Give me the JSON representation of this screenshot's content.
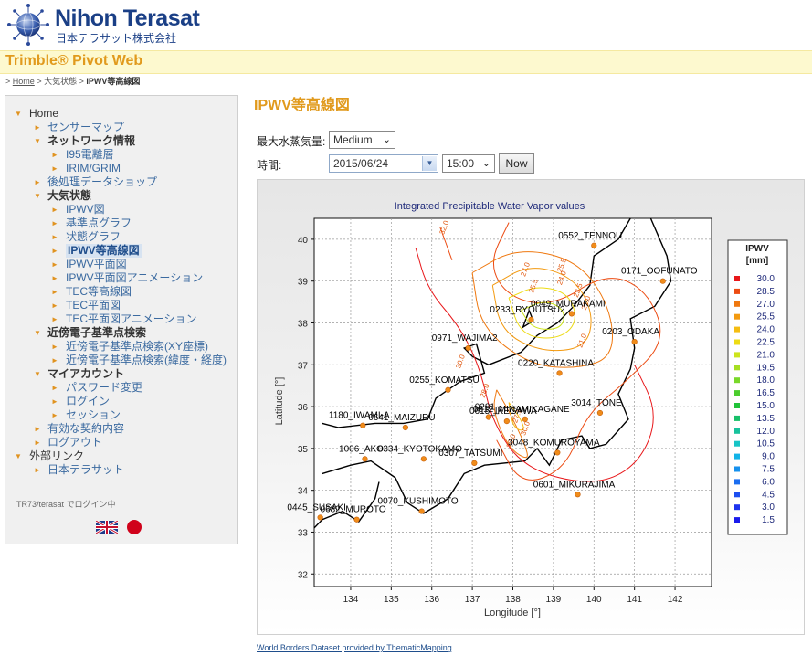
{
  "header": {
    "company_en": "Nihon Terasat",
    "company_ja": "日本テラサット株式会社",
    "app_title": "Trimble® Pivot Web"
  },
  "breadcrumb": {
    "prefix": ">",
    "home": "Home",
    "sep1": ">",
    "item1": "大気状態",
    "sep2": ">",
    "current": "IPWV等高線図"
  },
  "sidebar": {
    "items": [
      {
        "label": "Home"
      },
      {
        "label": "センサーマップ"
      },
      {
        "label": "ネットワーク情報"
      },
      {
        "label": "I95電離層"
      },
      {
        "label": "IRIM/GRIM"
      },
      {
        "label": "後処理データショップ"
      },
      {
        "label": "大気状態"
      },
      {
        "label": "IPWV図"
      },
      {
        "label": "基準点グラフ"
      },
      {
        "label": "状態グラフ"
      },
      {
        "label": "IPWV等高線図"
      },
      {
        "label": "IPWV平面図"
      },
      {
        "label": "IPWV平面図アニメーション"
      },
      {
        "label": "TEC等高線図"
      },
      {
        "label": "TEC平面図"
      },
      {
        "label": "TEC平面図アニメーション"
      },
      {
        "label": "近傍電子基準点検索"
      },
      {
        "label": "近傍電子基準点検索(XY座標)"
      },
      {
        "label": "近傍電子基準点検索(緯度・経度)"
      },
      {
        "label": "マイアカウント"
      },
      {
        "label": "パスワード変更"
      },
      {
        "label": "ログイン"
      },
      {
        "label": "セッション"
      },
      {
        "label": "有効な契約内容"
      },
      {
        "label": "ログアウト"
      },
      {
        "label": "外部リンク"
      },
      {
        "label": "日本テラサット"
      }
    ],
    "user_status": "TR73/terasat でログイン中"
  },
  "main": {
    "title": "IPWV等高線図",
    "max_label": "最大水蒸気量:",
    "max_value": "Medium",
    "time_label": "時間:",
    "date_value": "2015/06/24",
    "hour_value": "15:00",
    "now_button": "Now",
    "credit": "World Borders Dataset provided by ThematicMapping"
  },
  "chart_data": {
    "type": "contour",
    "title": "Integrated Precipitable Water Vapor values",
    "xlabel": "Longitude [°]",
    "ylabel": "Latitude [°]",
    "xlim": [
      133.1,
      142.9
    ],
    "ylim": [
      31.7,
      40.5
    ],
    "xticks": [
      134,
      135,
      136,
      137,
      138,
      139,
      140,
      141,
      142
    ],
    "yticks": [
      32,
      33,
      34,
      35,
      36,
      37,
      38,
      39,
      40
    ],
    "grid": true,
    "legend": {
      "title": "IPWV",
      "unit": "[mm]",
      "placement": "right",
      "levels": [
        {
          "value": "30.0",
          "color": "#e8171a"
        },
        {
          "value": "28.5",
          "color": "#ec4b12"
        },
        {
          "value": "27.0",
          "color": "#ef780f"
        },
        {
          "value": "25.5",
          "color": "#f39a10"
        },
        {
          "value": "24.0",
          "color": "#f5bd12"
        },
        {
          "value": "22.5",
          "color": "#eddb14"
        },
        {
          "value": "21.0",
          "color": "#cde41c"
        },
        {
          "value": "19.5",
          "color": "#a6df22"
        },
        {
          "value": "18.0",
          "color": "#79d82a"
        },
        {
          "value": "16.5",
          "color": "#4ccd2e"
        },
        {
          "value": "15.0",
          "color": "#22c33a"
        },
        {
          "value": "13.5",
          "color": "#18c06a"
        },
        {
          "value": "12.0",
          "color": "#18c29c"
        },
        {
          "value": "10.5",
          "color": "#17c4c6"
        },
        {
          "value": "9.0",
          "color": "#13b4e8"
        },
        {
          "value": "7.5",
          "color": "#1691ee"
        },
        {
          "value": "6.0",
          "color": "#1a6df0"
        },
        {
          "value": "4.5",
          "color": "#1c4ef0"
        },
        {
          "value": "3.0",
          "color": "#1d33ee"
        },
        {
          "value": "1.5",
          "color": "#1a1bec"
        }
      ]
    },
    "stations": [
      {
        "id": "0552_TENNOU",
        "lon": 140.0,
        "lat": 39.85
      },
      {
        "id": "0171_OOFUNATO",
        "lon": 141.7,
        "lat": 39.0
      },
      {
        "id": "0049_MURAKAMI",
        "lon": 139.45,
        "lat": 38.22
      },
      {
        "id": "0233_RYOUTSU2",
        "lon": 138.45,
        "lat": 38.08
      },
      {
        "id": "0971_WAJIMA2",
        "lon": 136.9,
        "lat": 37.4
      },
      {
        "id": "0203_ODAKA",
        "lon": 141.0,
        "lat": 37.55
      },
      {
        "id": "0220_KATASHINA",
        "lon": 139.15,
        "lat": 36.8
      },
      {
        "id": "0255_KOMATSU",
        "lon": 136.4,
        "lat": 36.4
      },
      {
        "id": "3014_TONE",
        "lon": 140.15,
        "lat": 35.85
      },
      {
        "id": "0281",
        "lon": 137.4,
        "lat": 35.75
      },
      {
        "id": "0615_IKEGAWA",
        "lon": 137.85,
        "lat": 35.65
      },
      {
        "id": "0612_MINAMIKAGANE",
        "lon": 138.3,
        "lat": 35.7
      },
      {
        "id": "1180_IWAMI-A",
        "lon": 134.3,
        "lat": 35.55
      },
      {
        "id": "0641_MAIZURU",
        "lon": 135.35,
        "lat": 35.5
      },
      {
        "id": "3048_KOMUROYAMA",
        "lon": 139.1,
        "lat": 34.9
      },
      {
        "id": "1006_AKO",
        "lon": 134.35,
        "lat": 34.75
      },
      {
        "id": "0334_KYOTOKAMO",
        "lon": 135.8,
        "lat": 34.75
      },
      {
        "id": "0307_TATSUMI",
        "lon": 137.05,
        "lat": 34.65
      },
      {
        "id": "0601_MIKURAJIMA",
        "lon": 139.6,
        "lat": 33.9
      },
      {
        "id": "0445_SUSAKI",
        "lon": 133.25,
        "lat": 33.35
      },
      {
        "id": "0682_MUROTO",
        "lon": 134.15,
        "lat": 33.3
      },
      {
        "id": "0070_KUSHIMOTO",
        "lon": 135.75,
        "lat": 33.5
      }
    ],
    "contour_labels": [
      "32.0",
      "30.0",
      "28.0",
      "27.0",
      "25.5",
      "25.5",
      "24.0",
      "22.5",
      "21.0",
      "21.0",
      "27.1",
      "30.0",
      "30.0"
    ]
  }
}
